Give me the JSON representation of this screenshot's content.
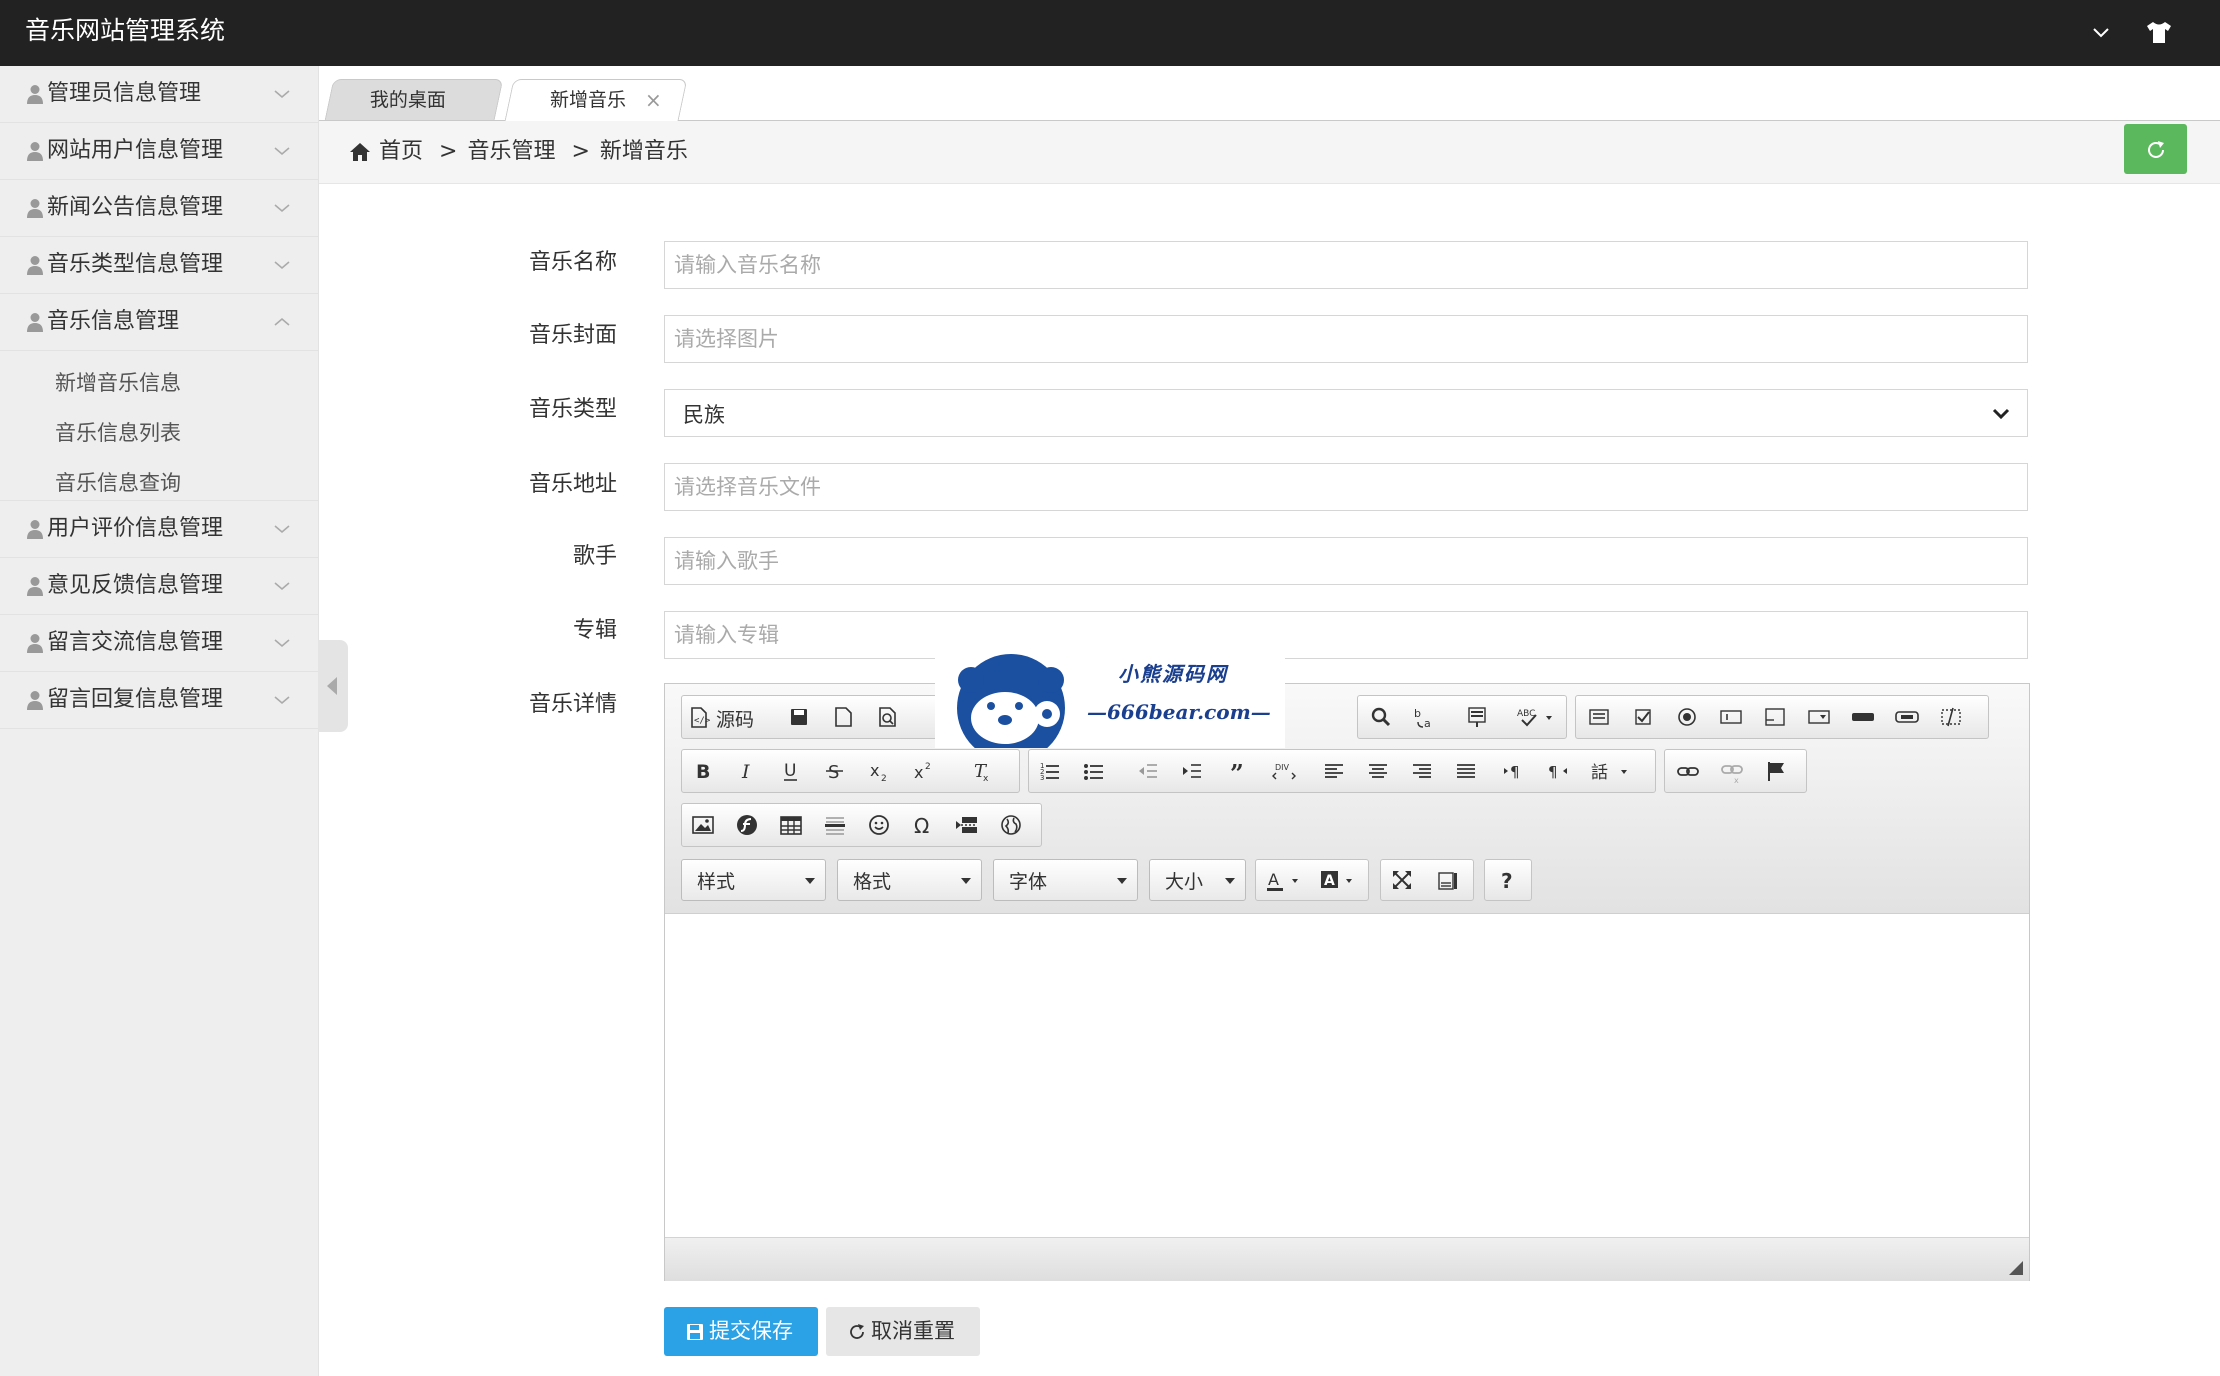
{
  "header": {
    "title": "音乐网站管理系统"
  },
  "sidebar": {
    "items_top": [
      {
        "label": "管理员信息管理"
      },
      {
        "label": "网站用户信息管理"
      },
      {
        "label": "新闻公告信息管理"
      },
      {
        "label": "音乐类型信息管理"
      },
      {
        "label": "音乐信息管理"
      }
    ],
    "sub_items": [
      {
        "label": "新增音乐信息"
      },
      {
        "label": "音乐信息列表"
      },
      {
        "label": "音乐信息查询"
      }
    ],
    "items_bottom": [
      {
        "label": "用户评价信息管理"
      },
      {
        "label": "意见反馈信息管理"
      },
      {
        "label": "留言交流信息管理"
      },
      {
        "label": "留言回复信息管理"
      }
    ]
  },
  "tabs": [
    {
      "label": "我的桌面"
    },
    {
      "label": "新增音乐",
      "close": "×"
    }
  ],
  "breadcrumb": {
    "home": "首页",
    "level1": "音乐管理",
    "level2": "新增音乐",
    "sep": ">"
  },
  "form": {
    "name": {
      "label": "音乐名称",
      "placeholder": "请输入音乐名称"
    },
    "cover": {
      "label": "音乐封面",
      "placeholder": "请选择图片"
    },
    "type": {
      "label": "音乐类型",
      "value": "民族"
    },
    "url": {
      "label": "音乐地址",
      "placeholder": "请选择音乐文件"
    },
    "singer": {
      "label": "歌手",
      "placeholder": "请输入歌手"
    },
    "album": {
      "label": "专辑",
      "placeholder": "请输入专辑"
    },
    "detail": {
      "label": "音乐详情"
    }
  },
  "editor": {
    "source_label": "源码",
    "combos": {
      "style": "样式",
      "format": "格式",
      "font": "字体",
      "size": "大小"
    }
  },
  "watermark": {
    "title": "小熊源码网",
    "url": "—666bear.com—"
  },
  "buttons": {
    "save": "提交保存",
    "reset": "取消重置"
  },
  "colors": {
    "header_bg": "#222222",
    "refresh": "#5cb85c",
    "save": "#2ba1e6",
    "sidebar_bg": "#eeeeee"
  }
}
